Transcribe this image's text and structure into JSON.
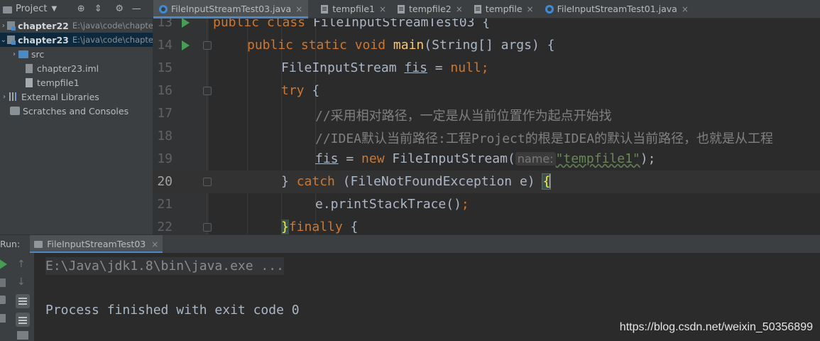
{
  "project_panel": {
    "title": "Project",
    "tree": [
      {
        "label": "chapter22",
        "path": "E:\\java\\code\\chapte",
        "expanded": false
      },
      {
        "label": "chapter23",
        "path": "E:\\java\\code\\chapte",
        "expanded": true,
        "selected": true
      },
      {
        "label": "src"
      },
      {
        "label": "chapter23.iml"
      },
      {
        "label": "tempfile1"
      },
      {
        "label": "External Libraries"
      },
      {
        "label": "Scratches and Consoles"
      }
    ]
  },
  "tabs": [
    {
      "label": "FileInputStreamTest03.java",
      "active": true,
      "close": "×"
    },
    {
      "label": "tempfile1",
      "close": "×"
    },
    {
      "label": "tempfile2",
      "close": "×"
    },
    {
      "label": "tempfile",
      "close": "×"
    },
    {
      "label": "FileInputStreamTest01.java",
      "close": "×"
    }
  ],
  "editor": {
    "lines": [
      {
        "num": "13",
        "seg": [
          "public ",
          "class ",
          "FileInputStreamTest03 {"
        ]
      },
      {
        "num": "14",
        "seg": [
          "public ",
          "static ",
          "void ",
          "main",
          "(String[] args) {"
        ]
      },
      {
        "num": "15",
        "seg": [
          "FileInputStream ",
          "fis",
          " = ",
          "null",
          ";"
        ]
      },
      {
        "num": "16",
        "seg": [
          "try",
          " {"
        ]
      },
      {
        "num": "17",
        "seg": [
          "//采用相对路径，一定是从当前位置作为起点开始找"
        ]
      },
      {
        "num": "18",
        "seg": [
          "//IDEA默认当前路径:工程Project的根是IDEA的默认当前路径，也就是从工程"
        ]
      },
      {
        "num": "19",
        "seg": [
          "fis",
          " = ",
          "new ",
          "FileInputStream(",
          "name:",
          "\"tempfile1\"",
          ");"
        ]
      },
      {
        "num": "20",
        "seg": [
          "} ",
          "catch ",
          "(FileNotFoundException e) ",
          "{"
        ]
      },
      {
        "num": "21",
        "seg": [
          "e.printStackTrace()",
          ";"
        ]
      },
      {
        "num": "22",
        "seg": [
          "}",
          "finally ",
          "{"
        ]
      }
    ]
  },
  "run_panel": {
    "label": "Run:",
    "tab": "FileInputStreamTest03",
    "tab_close": "×",
    "console": [
      "E:\\Java\\jdk1.8\\bin\\java.exe ...",
      "Process finished with exit code 0"
    ]
  },
  "watermark": "https://blog.csdn.net/weixin_50356899"
}
